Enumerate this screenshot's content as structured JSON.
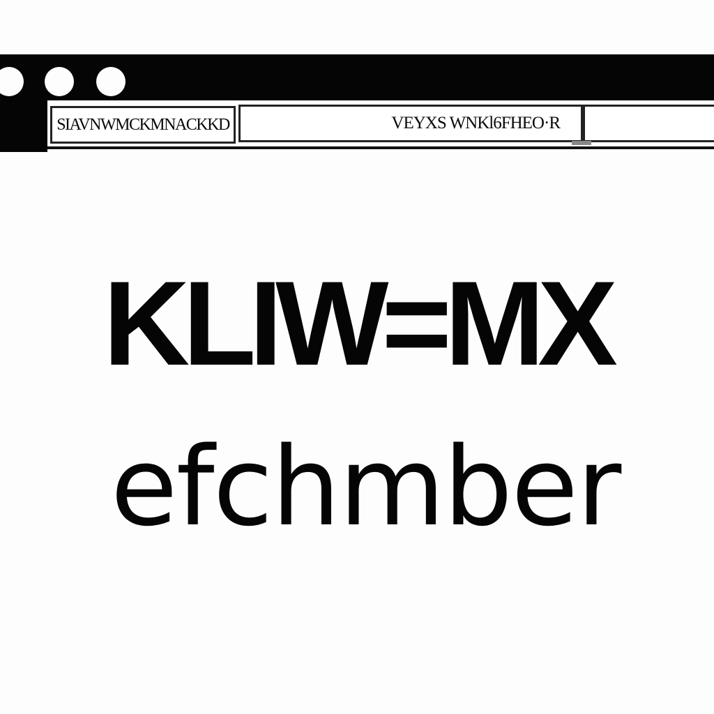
{
  "window": {
    "controls": [
      "close",
      "minimize",
      "maximize"
    ]
  },
  "toolbar": {
    "address_text": "SIAVNWMCKMNACKKD",
    "search_text": "VEYXS WNKl6FHEO·R"
  },
  "content": {
    "headline": "KLIW=MX",
    "subline": "efchmber"
  },
  "colors": {
    "background": "#fdfdfd",
    "bar": "#050505",
    "text": "#050505"
  }
}
